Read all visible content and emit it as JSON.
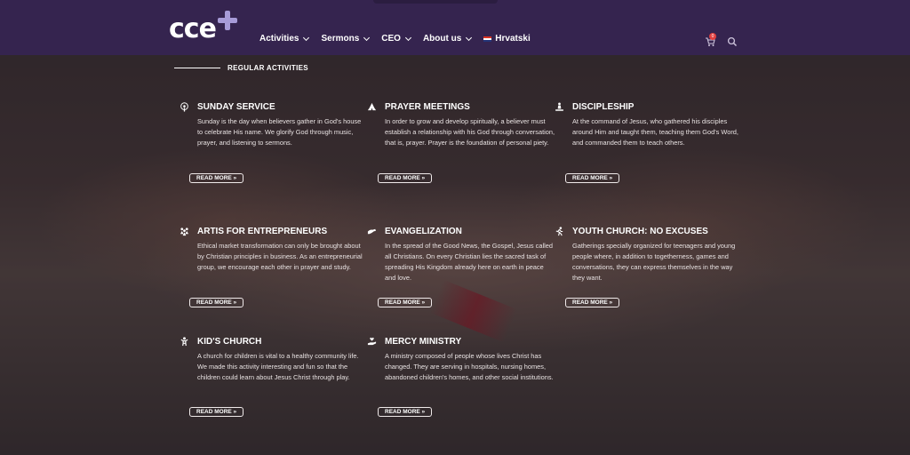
{
  "header": {
    "logo_text": "cce",
    "nav": [
      {
        "label": "Activities"
      },
      {
        "label": "Sermons"
      },
      {
        "label": "CEO"
      },
      {
        "label": "About us"
      },
      {
        "label": "Hrvatski"
      }
    ],
    "cart_count": "0"
  },
  "section": {
    "title": "REGULAR ACTIVITIES"
  },
  "cards": [
    {
      "title": "SUNDAY SERVICE",
      "icon": "podcast-icon",
      "text": "Sunday is the day when believers gather in God's house to celebrate His name. We glorify God through music, prayer, and listening to sermons.",
      "button": "READ MORE »"
    },
    {
      "title": "PRAYER MEETINGS",
      "icon": "praying-hands-icon",
      "text": "In order to grow and develop spiritually, a believer must establish a relationship with his God through conversation, that is, prayer. Prayer is the foundation of personal piety.",
      "button": "READ MORE »"
    },
    {
      "title": "DISCIPLESHIP",
      "icon": "meditation-icon",
      "text": "At the command of Jesus, who gathered his disciples around Him and taught them, teaching them God's Word, and commanded them to teach others.",
      "button": "READ MORE »"
    },
    {
      "title": "ARTIS FOR ENTREPRENEURS",
      "icon": "group-icon",
      "text": "Ethical market transformation can only be brought about by Christian principles in business. As an entrepreneurial group, we encourage each other in prayer and study.",
      "button": "READ MORE »"
    },
    {
      "title": "EVANGELIZATION",
      "icon": "hands-helping-icon",
      "text": "In the spread of the Good News, the Gospel, Jesus called all Christians. On every Christian lies the sacred task of spreading His Kingdom already here on earth in peace and love.",
      "button": "READ MORE »"
    },
    {
      "title": "YOUTH CHURCH: NO EXCUSES",
      "icon": "running-person-icon",
      "text": "Gatherings specially organized for teenagers and young people where, in addition to togetherness, games and conversations, they can express themselves in the way they want.",
      "button": "READ MORE »"
    },
    {
      "title": "KID'S CHURCH",
      "icon": "child-icon",
      "text": "A church for children is vital to a healthy community life. We made this activity interesting and fun so that the children could learn about Jesus Christ through play.",
      "button": "READ MORE »"
    },
    {
      "title": "MERCY MINISTRY",
      "icon": "hand-holding-heart-icon",
      "text": "A ministry composed of people whose lives Christ has changed. They are serving in hospitals, nursing homes, abandoned children's homes, and other social institutions.",
      "button": "READ MORE »"
    }
  ]
}
